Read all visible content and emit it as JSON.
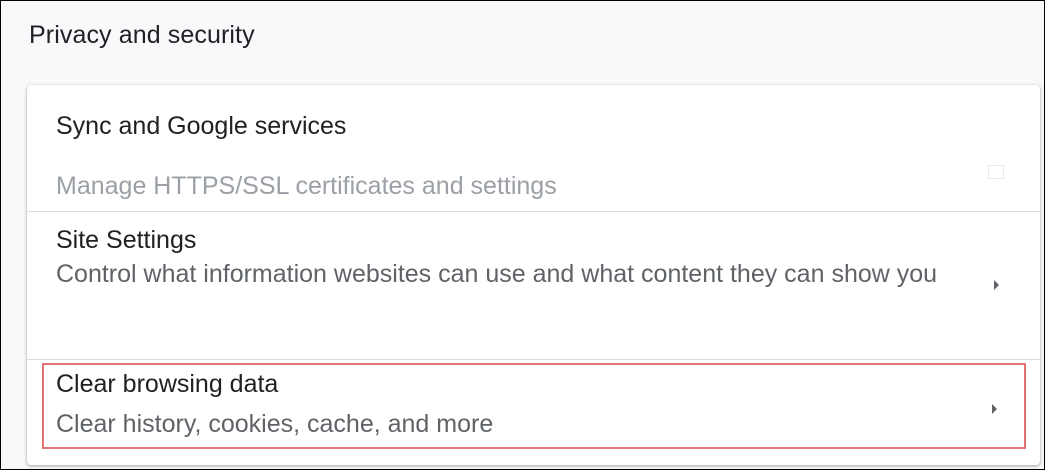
{
  "section": {
    "title": "Privacy and security"
  },
  "rows": {
    "sync": {
      "label": "Sync and Google services"
    },
    "certificates": {
      "sublabel": "Manage HTTPS/SSL certificates and settings",
      "icon": "open-in-new-icon"
    },
    "site_settings": {
      "label": "Site Settings",
      "sublabel": "Control what information websites can use and what content they can show you",
      "icon": "chevron-right-icon"
    },
    "clear_browsing": {
      "label": "Clear browsing data",
      "sublabel": "Clear history, cookies, cache, and more",
      "icon": "chevron-right-icon",
      "highlight_color": "#e57373"
    }
  },
  "colors": {
    "primary_text": "#202124",
    "secondary_text": "#5f6368",
    "faded_text": "#9aa0a6",
    "divider": "#dadce0",
    "page_background": "#f8f9fa",
    "card_background": "#ffffff"
  }
}
